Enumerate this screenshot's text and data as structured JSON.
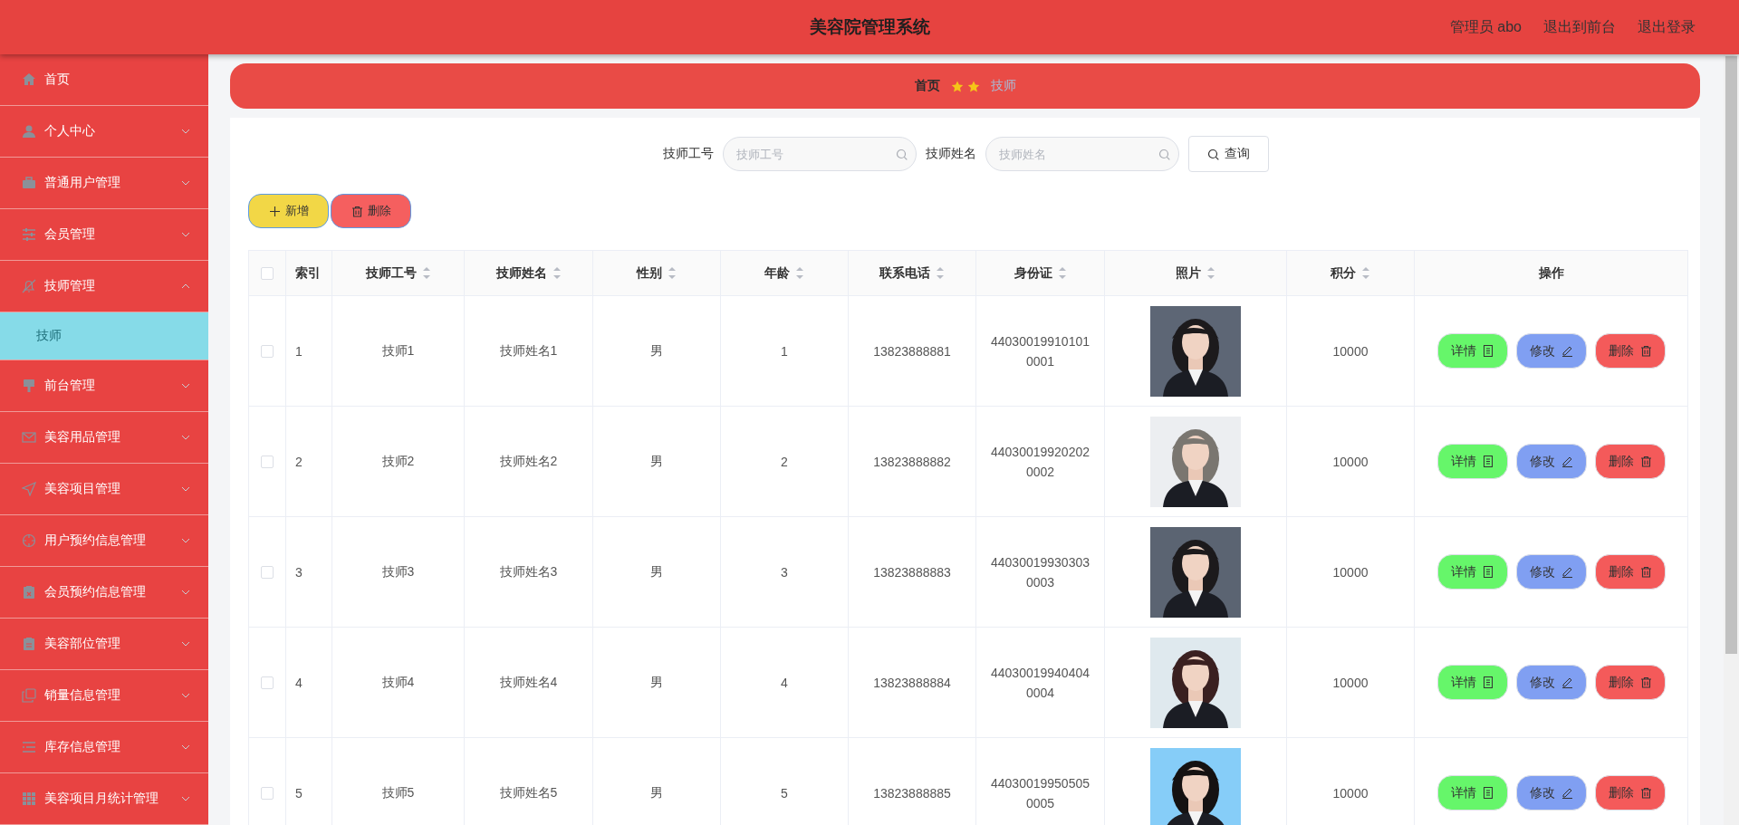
{
  "header": {
    "title": "美容院管理系统",
    "user": "管理员 abo",
    "links": [
      "退出到前台",
      "退出登录"
    ]
  },
  "sidebar": {
    "items": [
      {
        "label": "首页",
        "kind": "link"
      },
      {
        "label": "个人中心",
        "kind": "menu",
        "expanded": false
      },
      {
        "label": "普通用户管理",
        "kind": "menu",
        "expanded": false
      },
      {
        "label": "会员管理",
        "kind": "menu",
        "expanded": false
      },
      {
        "label": "技师管理",
        "kind": "menu",
        "expanded": true,
        "children": [
          {
            "label": "技师",
            "selected": true
          }
        ]
      },
      {
        "label": "前台管理",
        "kind": "menu",
        "expanded": false
      },
      {
        "label": "美容用品管理",
        "kind": "menu",
        "expanded": false
      },
      {
        "label": "美容项目管理",
        "kind": "menu",
        "expanded": false
      },
      {
        "label": "用户预约信息管理",
        "kind": "menu",
        "expanded": false
      },
      {
        "label": "会员预约信息管理",
        "kind": "menu",
        "expanded": false
      },
      {
        "label": "美容部位管理",
        "kind": "menu",
        "expanded": false
      },
      {
        "label": "销量信息管理",
        "kind": "menu",
        "expanded": false
      },
      {
        "label": "库存信息管理",
        "kind": "menu",
        "expanded": false
      },
      {
        "label": "美容项目月统计管理",
        "kind": "menu",
        "expanded": false
      }
    ]
  },
  "breadcrumb": [
    {
      "label": "首页",
      "kind": "link"
    },
    {
      "label": "技师",
      "kind": "current"
    }
  ],
  "search": {
    "fields": [
      {
        "label": "技师工号",
        "placeholder": "技师工号"
      },
      {
        "label": "技师姓名",
        "placeholder": "技师姓名"
      }
    ],
    "button": "查询"
  },
  "toolbar": [
    {
      "label": "新增",
      "kind": "add"
    },
    {
      "label": "删除",
      "kind": "delete"
    }
  ],
  "table": {
    "select_all": {
      "checked": false
    },
    "columns": [
      {
        "label": "索引",
        "sortable": false
      },
      {
        "label": "技师工号",
        "sortable": true
      },
      {
        "label": "技师姓名",
        "sortable": true
      },
      {
        "label": "性别",
        "sortable": true
      },
      {
        "label": "年龄",
        "sortable": true
      },
      {
        "label": "联系电话",
        "sortable": true
      },
      {
        "label": "身份证",
        "sortable": true
      },
      {
        "label": "照片",
        "sortable": true
      },
      {
        "label": "积分",
        "sortable": true
      },
      {
        "label": "操作",
        "sortable": false
      }
    ],
    "rows": [
      {
        "checked": false,
        "cells": [
          "1",
          "技师1",
          "技师姓名1",
          "男",
          "1",
          "13823888881",
          "440300199101010001"
        ],
        "points": "10000",
        "actions": [
          {
            "label": "详情",
            "kind": "detail"
          },
          {
            "label": "修改",
            "kind": "edit"
          },
          {
            "label": "删除",
            "kind": "delete"
          }
        ]
      },
      {
        "checked": false,
        "cells": [
          "2",
          "技师2",
          "技师姓名2",
          "男",
          "2",
          "13823888882",
          "440300199202020002"
        ],
        "points": "10000",
        "actions": [
          {
            "label": "详情",
            "kind": "detail"
          },
          {
            "label": "修改",
            "kind": "edit"
          },
          {
            "label": "删除",
            "kind": "delete"
          }
        ]
      },
      {
        "checked": false,
        "cells": [
          "3",
          "技师3",
          "技师姓名3",
          "男",
          "3",
          "13823888883",
          "440300199303030003"
        ],
        "points": "10000",
        "actions": [
          {
            "label": "详情",
            "kind": "detail"
          },
          {
            "label": "修改",
            "kind": "edit"
          },
          {
            "label": "删除",
            "kind": "delete"
          }
        ]
      },
      {
        "checked": false,
        "cells": [
          "4",
          "技师4",
          "技师姓名4",
          "男",
          "4",
          "13823888884",
          "440300199404040004"
        ],
        "points": "10000",
        "actions": [
          {
            "label": "详情",
            "kind": "detail"
          },
          {
            "label": "修改",
            "kind": "edit"
          },
          {
            "label": "删除",
            "kind": "delete"
          }
        ]
      },
      {
        "checked": false,
        "cells": [
          "5",
          "技师5",
          "技师姓名5",
          "男",
          "5",
          "13823888885",
          "440300199505050005"
        ],
        "points": "10000",
        "actions": [
          {
            "label": "详情",
            "kind": "detail"
          },
          {
            "label": "修改",
            "kind": "edit"
          },
          {
            "label": "删除",
            "kind": "delete"
          }
        ]
      }
    ]
  }
}
